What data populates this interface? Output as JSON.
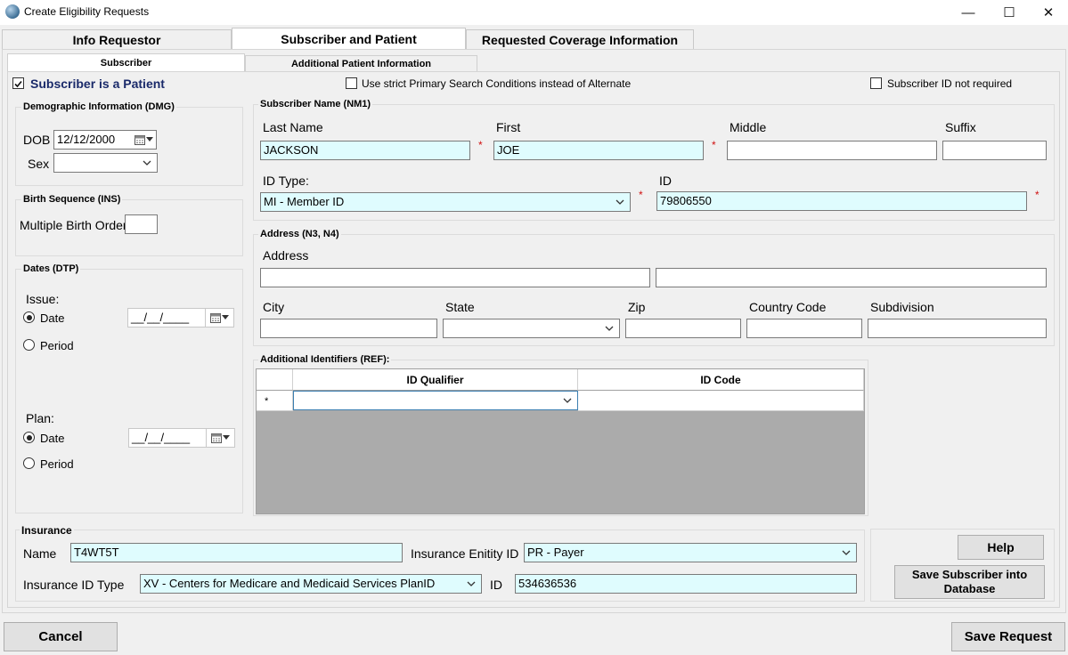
{
  "window": {
    "title": "Create Eligibility Requests",
    "minimize_glyph": "—",
    "maximize_glyph": "☐",
    "close_glyph": "✕"
  },
  "tabs": [
    {
      "label": "Info Requestor"
    },
    {
      "label": "Subscriber and Patient"
    },
    {
      "label": "Requested Coverage Information"
    }
  ],
  "subtabs": [
    {
      "label": "Subscriber"
    },
    {
      "label": "Additional Patient Information"
    }
  ],
  "options": {
    "subscriber_is_patient": {
      "label": "Subscriber is a Patient",
      "checked": true
    },
    "strict_primary": {
      "label": "Use strict Primary  Search Conditions instead of Alternate",
      "checked": false
    },
    "id_not_required": {
      "label": "Subscriber ID not required",
      "checked": false
    }
  },
  "demographic": {
    "title": "Demographic Information (DMG)",
    "dob_label": "DOB",
    "dob_value": "12/12/2000",
    "sex_label": "Sex",
    "sex_value": ""
  },
  "birth_sequence": {
    "title": "Birth Sequence (INS)",
    "multiple_birth_label": "Multiple Birth Order",
    "multiple_birth_value": ""
  },
  "dates": {
    "title": "Dates (DTP)",
    "issue_label": "Issue:",
    "plan_label": "Plan:",
    "date_label": "Date",
    "period_label": "Period",
    "issue_date_value": "__/__/____",
    "plan_date_value": "__/__/____",
    "issue_selected": "Date",
    "plan_selected": "Date"
  },
  "subscriber_name": {
    "title": "Subscriber Name (NM1)",
    "last_name_label": "Last Name",
    "last_name": "JACKSON",
    "first_label": "First",
    "first": "JOE",
    "middle_label": "Middle",
    "middle": "",
    "suffix_label": "Suffix",
    "suffix": "",
    "id_type_label": "ID Type:",
    "id_type": "MI - Member ID",
    "id_label": "ID",
    "id": "79806550",
    "required_mark": "*"
  },
  "address": {
    "title": "Address (N3, N4)",
    "address_label": "Address",
    "address1": "",
    "address2": "",
    "city_label": "City",
    "city": "",
    "state_label": "State",
    "state": "",
    "zip_label": "Zip",
    "zip": "",
    "country_label": "Country Code",
    "country": "",
    "subdivision_label": "Subdivision",
    "subdivision": ""
  },
  "additional_identifiers": {
    "title": "Additional Identifiers (REF):",
    "columns": [
      "ID Qualifier",
      "ID Code"
    ],
    "new_row_marker": "*",
    "rows": [
      {
        "qualifier": "",
        "code": ""
      }
    ]
  },
  "insurance": {
    "title": "Insurance",
    "name_label": "Name",
    "name": "T4WT5T",
    "entity_id_label": "Insurance Enitity ID",
    "entity_id": "PR - Payer",
    "id_type_label": "Insurance ID Type",
    "id_type": "XV - Centers for Medicare and Medicaid Services PlanID",
    "id_label": "ID",
    "id": "534636536"
  },
  "buttons": {
    "help": "Help",
    "save_subscriber": "Save Subscriber into Database",
    "cancel": "Cancel",
    "save_request": "Save Request"
  },
  "colors": {
    "required_field": "#dffcfe",
    "required_mark": "#d01010",
    "subscriber_label": "#1a2a6a"
  }
}
